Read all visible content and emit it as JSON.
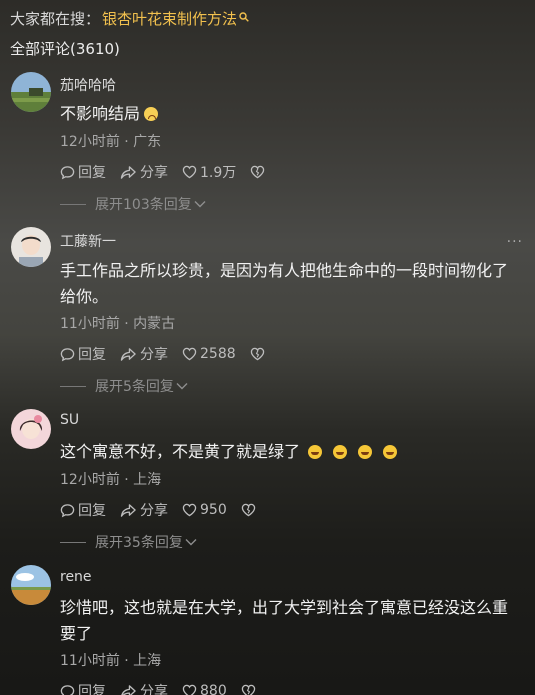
{
  "header": {
    "prefix": "大家都在搜：",
    "hot_search": "银杏叶花束制作方法",
    "search_icon": "search-icon",
    "comment_count_label": "全部评论(3610)"
  },
  "actions_labels": {
    "reply": "回复",
    "share": "分享"
  },
  "colors": {
    "accent": "#f2c14e",
    "text": "#f2f2f2",
    "muted": "#a8a8a8"
  },
  "comments": [
    {
      "user": "茄哈哈哈",
      "text": "不影响结局",
      "emoji": "sad-face",
      "time_loc": "12小时前 · 广东",
      "likes": "1.9万",
      "expand": "展开103条回复"
    },
    {
      "user": "工藤新一",
      "text": "手工作品之所以珍贵，是因为有人把他生命中的一段时间物化了给你。",
      "time_loc": "11小时前 · 内蒙古",
      "likes": "2588",
      "expand": "展开5条回复",
      "more": "···"
    },
    {
      "user": "SU",
      "text": "这个寓意不好，不是黄了就是绿了",
      "emoji_count": 4,
      "time_loc": "12小时前 · 上海",
      "likes": "950",
      "expand": "展开35条回复"
    },
    {
      "user": "rene",
      "text": "珍惜吧，这也就是在大学，出了大学到社会了寓意已经没这么重要了",
      "time_loc": "11小时前 · 上海",
      "likes": "880"
    }
  ]
}
